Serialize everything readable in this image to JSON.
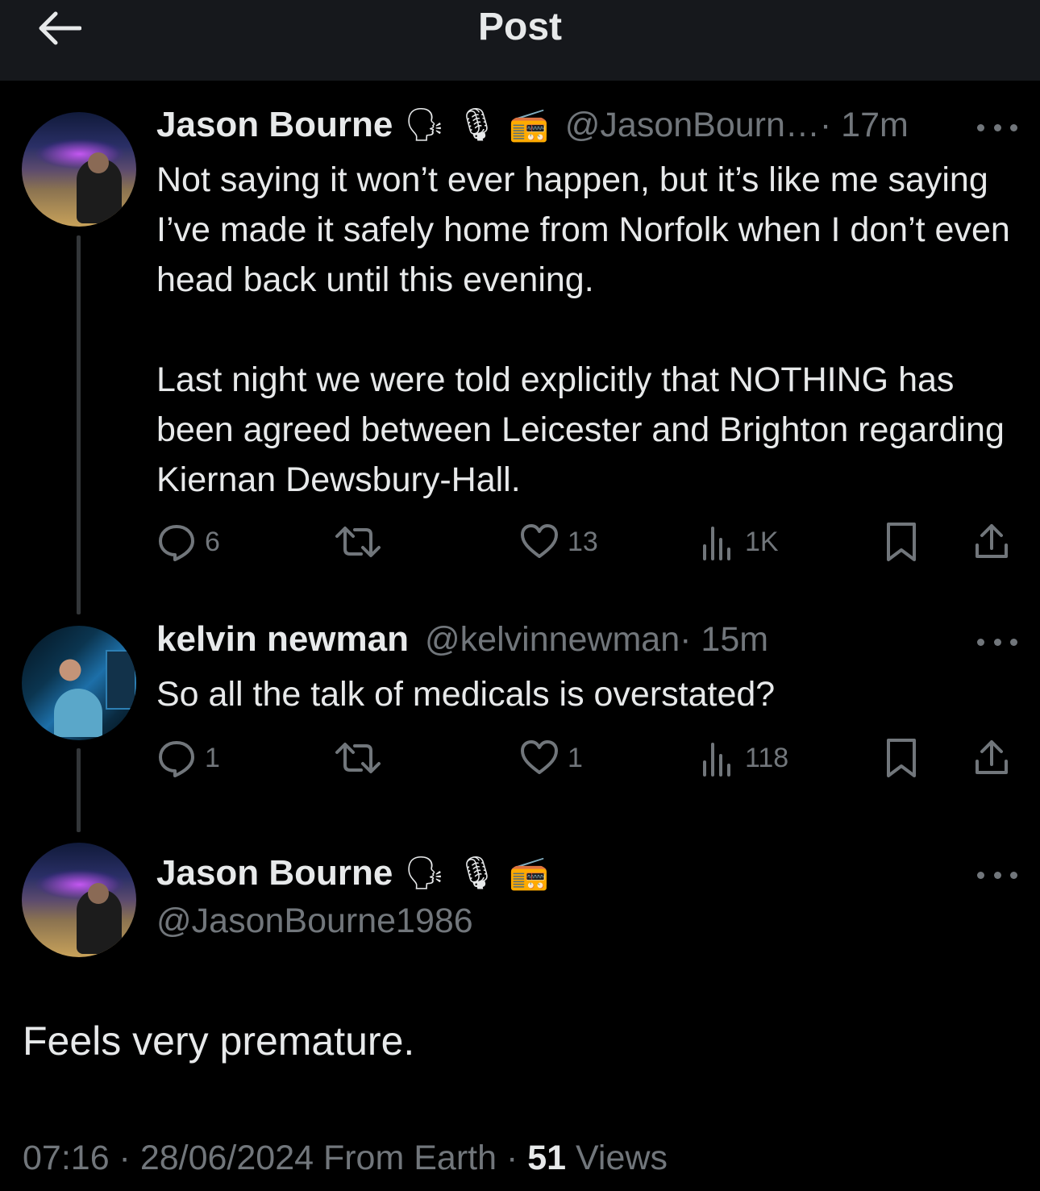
{
  "header": {
    "title": "Post"
  },
  "tweet1": {
    "name": "Jason Bourne",
    "emojis": [
      "🗣",
      "🎙",
      "📻"
    ],
    "handle": "@JasonBourn…",
    "time": "· 17m",
    "text": "Not saying it won’t ever happen, but it’s like me saying I’ve made it safely home from Norfolk when I don’t even head back until  this evening.\n\nLast night we were told explicitly that NOTHING has been agreed between Leicester and Brighton regarding Kiernan Dewsbury-Hall.",
    "replies": "6",
    "likes": "13",
    "views": "1K"
  },
  "tweet2": {
    "name": "kelvin newman",
    "handle": "@kelvinnewman",
    "time": "· 15m",
    "text": "So all the talk of medicals is overstated?",
    "replies": "1",
    "likes": "1",
    "views": "118"
  },
  "focus": {
    "name": "Jason Bourne",
    "emojis": [
      "🗣",
      "🎙",
      "📻"
    ],
    "handle": "@JasonBourne1986",
    "text": "Feels very premature.",
    "time": "07:16 · 28/06/2024 From Earth · ",
    "views_count": "51",
    "views_label": " Views"
  },
  "colors": {
    "background": "#000000",
    "header_bg": "#16181c",
    "text": "#e7e9ea",
    "muted": "#71767b",
    "thread_line": "#333639"
  }
}
